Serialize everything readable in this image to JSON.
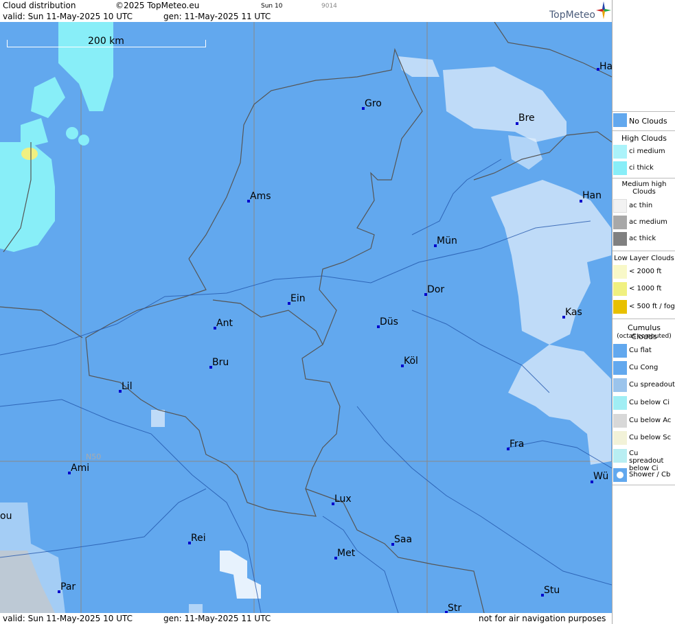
{
  "header": {
    "title": "Cloud distribution",
    "copyright": "©2025 TopMeteo.eu",
    "day_label": "Sun 10",
    "code": "9014",
    "valid": "valid:  Sun  11-May-2025  10 UTC",
    "generated": "gen: 11-May-2025 11 UTC",
    "logo": "TopMeteo"
  },
  "footer": {
    "valid": "valid:  Sun  11-May-2025  10 UTC",
    "generated": "gen: 11-May-2025 11 UTC",
    "disclaimer": "not for air navigation purposes"
  },
  "map": {
    "scale_label": "200 km",
    "latitude_label": "N50",
    "cities": [
      "Ha",
      "Gro",
      "Bre",
      "Ams",
      "Han",
      "Mün",
      "Ein",
      "Dor",
      "Ant",
      "Düs",
      "Kas",
      "Bru",
      "Köl",
      "Lil",
      "Fra",
      "Ami",
      "Wü",
      "Lux",
      "ou",
      "Rei",
      "Saa",
      "Met",
      "Par",
      "Stu",
      "Str"
    ]
  },
  "legend": {
    "no_clouds": "No Clouds",
    "high_title": "High Clouds",
    "ci_medium": "ci medium",
    "ci_thick": "ci thick",
    "medium_title": "Medium high Clouds",
    "ac_thin": "ac thin",
    "ac_medium": "ac medium",
    "ac_thick": "ac thick",
    "low_title": "Low Layer Clouds",
    "low_2000": "< 2000 ft",
    "low_1000": "< 1000 ft",
    "low_500": "< 500 ft / fog",
    "cu_title": "Cumulus Clouds",
    "cu_sub": "(octas computed)",
    "cu_flat": "Cu flat",
    "cu_cong": "Cu Cong",
    "cu_spreadout": "Cu spreadout",
    "cu_below_ci": "Cu below Ci",
    "cu_below_ac": "Cu below Ac",
    "cu_below_sc": "Cu below Sc",
    "cu_spread_below_ci": "Cu spreadout below Ci",
    "shower": "Shower / Cb",
    "colors": {
      "no_clouds": "#62a8ee",
      "ci": "#88eef8",
      "ac_medium": "#a8a8a8",
      "ac_thick": "#808080",
      "low_2000": "#f8f8c8",
      "low_1000": "#f0f080",
      "low_500": "#e8c000"
    }
  }
}
